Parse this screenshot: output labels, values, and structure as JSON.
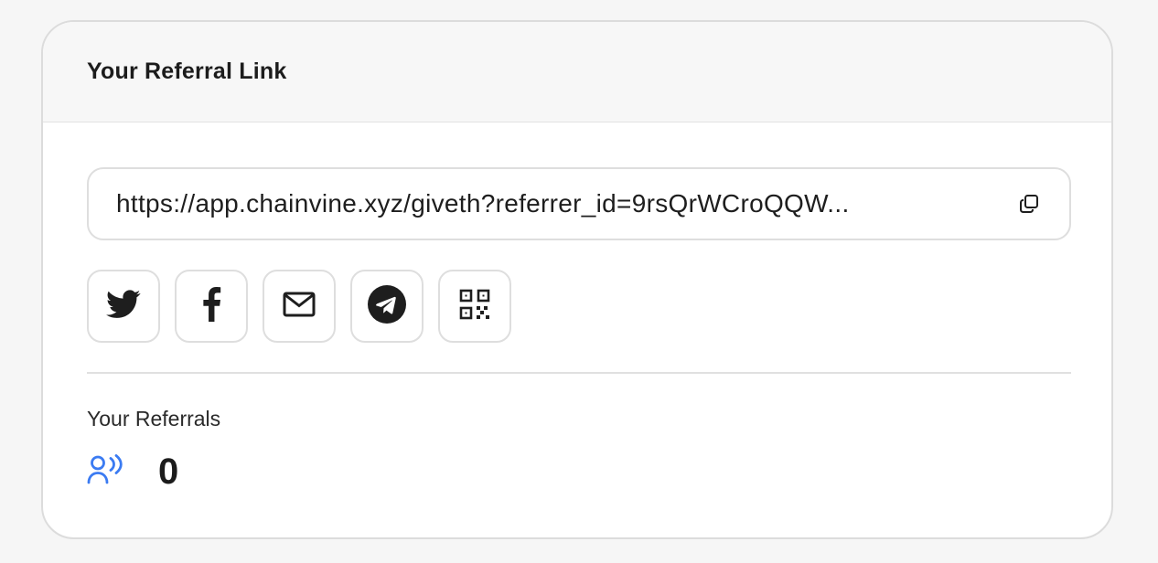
{
  "card": {
    "title": "Your Referral Link"
  },
  "referral_link": {
    "url": "https://app.chainvine.xyz/giveth?referrer_id=9rsQrWCroQQW...",
    "copy_icon": "copy-icon"
  },
  "share_buttons": [
    {
      "icon": "twitter-icon"
    },
    {
      "icon": "facebook-icon"
    },
    {
      "icon": "mail-icon"
    },
    {
      "icon": "telegram-icon"
    },
    {
      "icon": "qr-code-icon"
    }
  ],
  "referrals": {
    "label": "Your Referrals",
    "count": "0",
    "icon": "referrals-icon",
    "icon_color": "#3b7bf2"
  }
}
